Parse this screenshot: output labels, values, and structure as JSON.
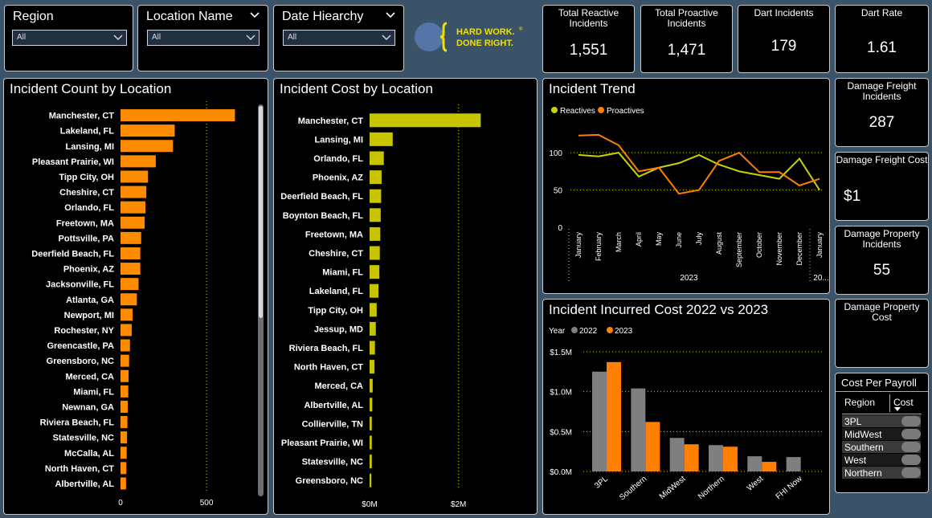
{
  "slicers": [
    {
      "title": "Region",
      "value": "All"
    },
    {
      "title": "Location Name",
      "value": "All"
    },
    {
      "title": "Date Hiearchy",
      "value": "All"
    }
  ],
  "logo": {
    "line1": "HARD WORK.",
    "line2": "DONE RIGHT.",
    "registered": "®"
  },
  "kpis": {
    "reactive": {
      "title": "Total Reactive Incidents",
      "value": "1,551"
    },
    "proactive": {
      "title": "Total Proactive Incidents",
      "value": "1,471"
    },
    "dart_incidents": {
      "title": "Dart Incidents",
      "value": "179"
    },
    "dart_rate": {
      "title": "Dart Rate",
      "value": "1.61"
    },
    "dmg_freight_inc": {
      "title": "Damage Freight Incidents",
      "value": "287"
    },
    "dmg_freight_cost": {
      "title": "Damage Freight Cost",
      "value": "$1"
    },
    "dmg_prop_inc": {
      "title": "Damage Property Incidents",
      "value": "55"
    },
    "dmg_prop_cost": {
      "title": "Damage Property Cost",
      "value": ""
    }
  },
  "cost_per_payroll": {
    "title": "Cost Per Payroll",
    "headers": [
      "Region",
      "Cost"
    ],
    "rows": [
      "3PL",
      "MidWest",
      "Southern",
      "West",
      "Northern"
    ]
  },
  "chart_data": [
    {
      "type": "bar",
      "orientation": "horizontal",
      "title": "Incident Count by Location",
      "color": "#ff8c00",
      "categories": [
        "Manchester, CT",
        "Lakeland, FL",
        "Lansing, MI",
        "Pleasant Prairie, WI",
        "Tipp City, OH",
        "Cheshire, CT",
        "Orlando, FL",
        "Freetown, MA",
        "Pottsville, PA",
        "Deerfield Beach, FL",
        "Phoenix, AZ",
        "Jacksonville, FL",
        "Atlanta, GA",
        "Newport, MI",
        "Rochester, NY",
        "Greencastle, PA",
        "Greensboro, NC",
        "Merced, CA",
        "Miami, FL",
        "Newnan, GA",
        "Riviera Beach, FL",
        "Statesville, NC",
        "McCalla, AL",
        "North Haven, CT",
        "Albertville, AL"
      ],
      "values": [
        665,
        315,
        305,
        205,
        160,
        150,
        145,
        140,
        120,
        115,
        115,
        105,
        95,
        70,
        65,
        55,
        50,
        47,
        45,
        42,
        40,
        38,
        36,
        34,
        32
      ],
      "xticks": [
        "0",
        "500"
      ],
      "xlim": [
        0,
        850
      ]
    },
    {
      "type": "bar",
      "orientation": "horizontal",
      "title": "Incident Cost by Location",
      "color": "#c8c400",
      "categories": [
        "Manchester, CT",
        "Lansing, MI",
        "Orlando, FL",
        "Phoenix, AZ",
        "Deerfield Beach, FL",
        "Boynton Beach, FL",
        "Freetown, MA",
        "Cheshire, CT",
        "Miami, FL",
        "Lakeland, FL",
        "Tipp City, OH",
        "Jessup, MD",
        "Riviera Beach, FL",
        "North Haven, CT",
        "Merced, CA",
        "Albertville, AL",
        "Collierville, TN",
        "Pleasant Prairie, WI",
        "Statesville, NC",
        "Greensboro, NC"
      ],
      "values": [
        2.5,
        0.52,
        0.32,
        0.27,
        0.26,
        0.25,
        0.24,
        0.23,
        0.22,
        0.2,
        0.16,
        0.14,
        0.12,
        0.11,
        0.07,
        0.06,
        0.05,
        0.05,
        0.05,
        0.04
      ],
      "xticks": [
        "$0M",
        "$2M"
      ],
      "xlim": [
        0,
        3.0
      ]
    },
    {
      "type": "line",
      "title": "Incident Trend",
      "legend": "top-left",
      "x": [
        "January",
        "February",
        "March",
        "April",
        "May",
        "June",
        "July",
        "August",
        "September",
        "October",
        "November",
        "December",
        "January"
      ],
      "group_labels": [
        "2023",
        "20..."
      ],
      "series": [
        {
          "name": "Reactives",
          "color": "#c8d400",
          "values": [
            97,
            95,
            100,
            68,
            80,
            86,
            97,
            84,
            75,
            70,
            65,
            92,
            50
          ]
        },
        {
          "name": "Proactives",
          "color": "#ff7f00",
          "values": [
            123,
            124,
            110,
            75,
            80,
            45,
            50,
            89,
            100,
            74,
            74,
            56,
            65
          ]
        }
      ],
      "yticks": [
        "0",
        "50",
        "100"
      ],
      "ylim": [
        0,
        140
      ]
    },
    {
      "type": "bar",
      "title": "Incident Incurred Cost 2022 vs 2023",
      "legend_title": "Year",
      "categories": [
        "3PL",
        "Southern",
        "MidWest",
        "Northern",
        "West",
        "FHI Now"
      ],
      "series": [
        {
          "name": "2022",
          "color": "#7f7f7f",
          "values": [
            1.25,
            1.04,
            0.42,
            0.33,
            0.19,
            0.18
          ]
        },
        {
          "name": "2023",
          "color": "#ff7f00",
          "values": [
            1.37,
            0.62,
            0.34,
            0.31,
            0.12,
            0
          ]
        }
      ],
      "yticks": [
        "$0.0M",
        "$0.5M",
        "$1.0M",
        "$1.5M"
      ],
      "ylim": [
        0,
        1.6
      ]
    }
  ]
}
